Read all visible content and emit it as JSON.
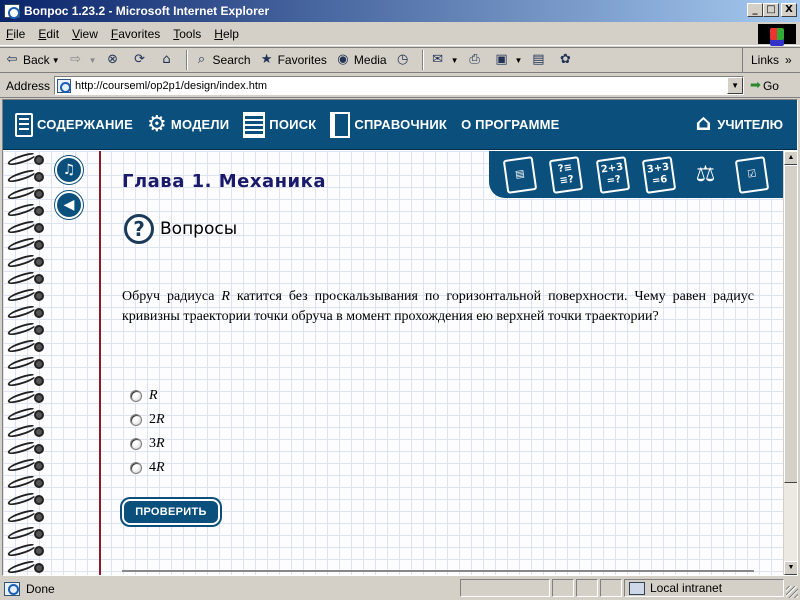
{
  "window": {
    "title": "Вопрос 1.23.2 - Microsoft Internet Explorer",
    "min": "_",
    "max": "□",
    "close": "X"
  },
  "menu": [
    "File",
    "Edit",
    "View",
    "Favorites",
    "Tools",
    "Help"
  ],
  "toolbar": {
    "back": "Back",
    "search": "Search",
    "favorites": "Favorites",
    "media": "Media",
    "links": "Links"
  },
  "address": {
    "label": "Address",
    "url": "http://courseml/op2p1/design/index.htm",
    "go": "Go"
  },
  "nav": {
    "contents": "СОДЕРЖАНИЕ",
    "models": "МОДЕЛИ",
    "search": "ПОИСК",
    "reference": "СПРАВОЧНИК",
    "about": "О ПРОГРАММЕ",
    "teacher": "УЧИТЕЛЮ"
  },
  "tabs": {
    "quiz": "?≡\n≡?",
    "sum1": "2+3\n=?",
    "sum2": "3+3\n=6"
  },
  "page": {
    "chapter": "Глава 1. Механика",
    "section": "Вопросы",
    "question_pre": "Обруч радиуса ",
    "question_var": "R",
    "question_post": " катится без проскальзывания по горизонтальной поверхности. Чему равен радиус кривизны траектории точки обруча в момент прохождения ею верхней точки траектории?",
    "options": [
      {
        "coef": "",
        "var": "R"
      },
      {
        "coef": "2",
        "var": "R"
      },
      {
        "coef": "3",
        "var": "R"
      },
      {
        "coef": "4",
        "var": "R"
      }
    ],
    "check_button": "ПРОВЕРИТЬ"
  },
  "status": {
    "text": "Done",
    "zone": "Local intranet"
  }
}
